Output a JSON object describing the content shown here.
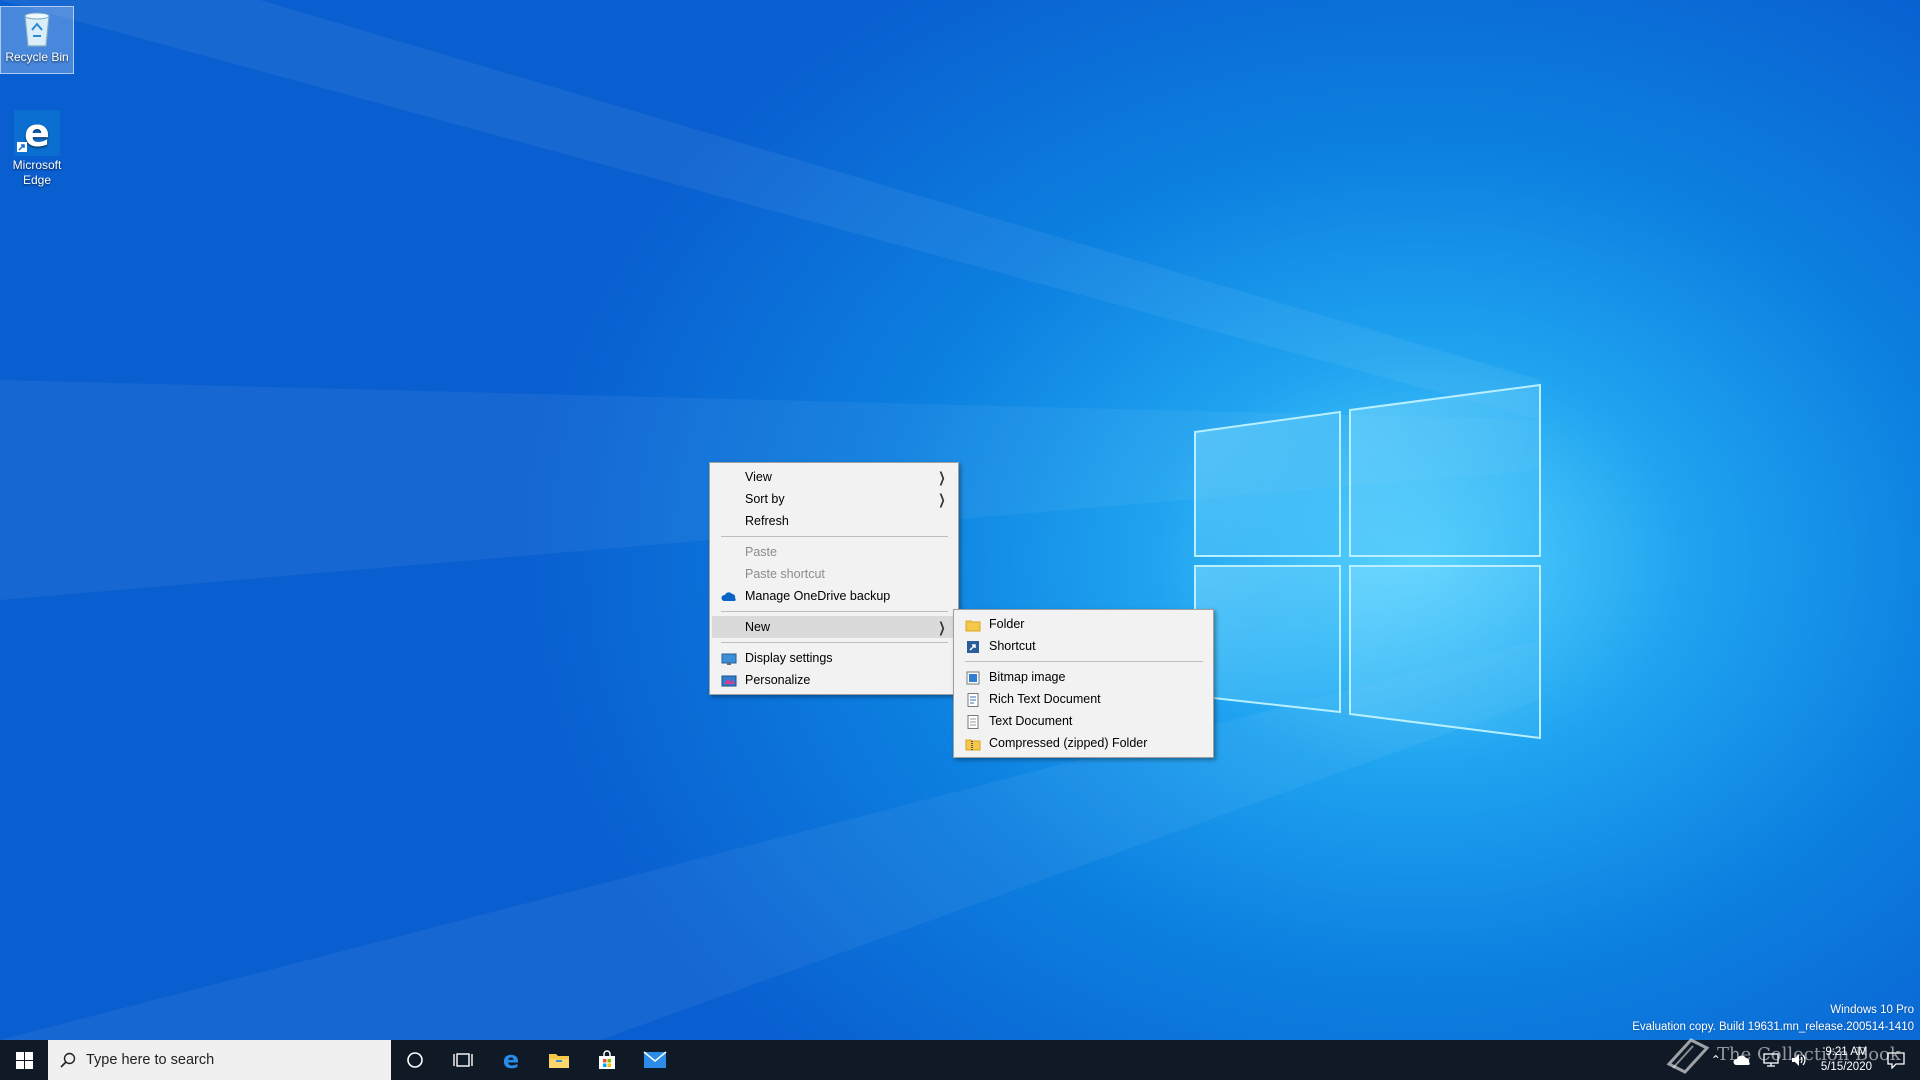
{
  "desktop": {
    "icons": [
      {
        "label": "Recycle Bin"
      },
      {
        "label": "Microsoft Edge"
      }
    ]
  },
  "context_menu": {
    "items": [
      {
        "label": "View",
        "has_submenu": true
      },
      {
        "label": "Sort by",
        "has_submenu": true
      },
      {
        "label": "Refresh"
      },
      {
        "label": "Paste",
        "disabled": true
      },
      {
        "label": "Paste shortcut",
        "disabled": true
      },
      {
        "label": "Manage OneDrive backup",
        "icon": "onedrive-icon"
      },
      {
        "label": "New",
        "has_submenu": true,
        "highlighted": true
      },
      {
        "label": "Display settings",
        "icon": "display-icon"
      },
      {
        "label": "Personalize",
        "icon": "personalize-icon"
      }
    ]
  },
  "new_submenu": {
    "items": [
      {
        "label": "Folder",
        "icon": "folder-icon"
      },
      {
        "label": "Shortcut",
        "icon": "shortcut-icon"
      },
      {
        "label": "Bitmap image",
        "icon": "bitmap-icon"
      },
      {
        "label": "Rich Text Document",
        "icon": "rtf-icon"
      },
      {
        "label": "Text Document",
        "icon": "text-doc-icon"
      },
      {
        "label": "Compressed (zipped) Folder",
        "icon": "zip-folder-icon"
      }
    ]
  },
  "taskbar": {
    "search_placeholder": "Type here to search",
    "clock_time": "9:21 AM",
    "clock_date": "5/15/2020"
  },
  "watermark": {
    "line1": "Windows 10 Pro",
    "line2": "Evaluation copy. Build 19631.mn_release.200514-1410",
    "logo_text": "The Collection Book"
  },
  "colors": {
    "taskbar": "#101a26",
    "menu_bg": "#f2f2f2",
    "highlight": "#dadada",
    "accent": "#0078d7"
  }
}
